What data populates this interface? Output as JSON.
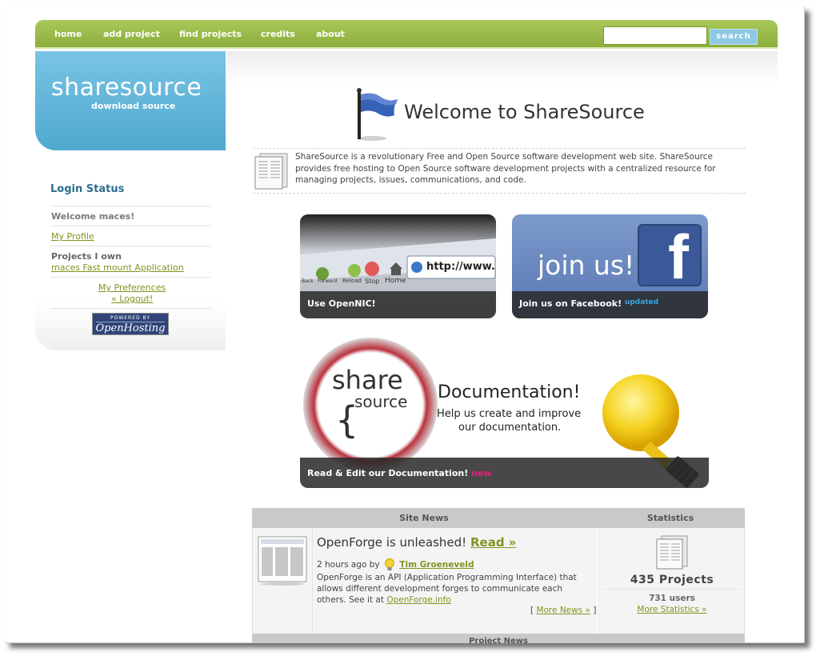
{
  "nav": {
    "items": [
      "home",
      "add project",
      "find projects",
      "credits",
      "about"
    ],
    "search_placeholder": "",
    "search_label": "search"
  },
  "sidebar": {
    "logo_title": "sharesource",
    "logo_sub": "download source",
    "login_heading": "Login Status",
    "welcome": "Welcome maces!",
    "my_profile": "My Profile",
    "projects_own_label": "Projects I own",
    "project_link": "maces Fast mount Application",
    "my_preferences": "My Preferences",
    "logout": "« Logout!",
    "powered_top": "POWERED BY",
    "powered_name": "OpenHosting"
  },
  "main": {
    "welcome_title": "Welcome to ShareSource",
    "intro": "ShareSource is a revolutionary Free and Open Source software development web site. ShareSource provides free hosting to Open Source software development projects with a centralized resource for managing projects, issues, communications, and code.",
    "promo_opennic": {
      "caption": "Use OpenNIC!",
      "url_text": "http://www.",
      "toolbar": [
        "Back",
        "Forward",
        "Reload",
        "Stop",
        "Home"
      ]
    },
    "promo_facebook": {
      "caption": "Join us on Facebook!",
      "badge": "updated",
      "headline": "join us!",
      "logo_letter": "f"
    },
    "promo_docs": {
      "caption": "Read & Edit our Documentation!",
      "badge": "new",
      "logo_top": "share",
      "logo_bottom": "source",
      "logo_brace": "{",
      "headline": "Documentation!",
      "sub1": "Help us create and improve",
      "sub2": "our documentation."
    }
  },
  "news": {
    "header_left": "Site News",
    "header_right": "Statistics",
    "title": "OpenForge is unleashed!",
    "read_more": "Read »",
    "meta_time": "2 hours ago by",
    "author": "Tim Groeneveld",
    "body": "OpenForge is an API (Application Programming Interface) that allows different development forges to communicate each others. See it at ",
    "body_link": "OpenForge.info",
    "more_news_open": "[",
    "more_news": "More News »",
    "more_news_close": "]",
    "project_news": "Project News"
  },
  "stats": {
    "projects": "435 Projects",
    "users": "731 users",
    "more": "More Statistics »"
  },
  "colors": {
    "nav_green": "#8cae3c",
    "sidebar_blue": "#4fa9cf",
    "link_green": "#7c9620",
    "heading_blue": "#2f6e8e",
    "badge_blue": "#3aa3e0",
    "badge_pink": "#e0207a"
  }
}
